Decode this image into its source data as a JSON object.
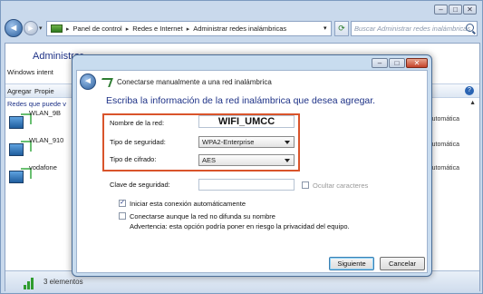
{
  "explorer": {
    "breadcrumb": [
      "Panel de control",
      "Redes e Internet",
      "Administrar redes inalámbricas"
    ],
    "search_placeholder": "Buscar Administrar redes inalámbricas",
    "heading": "Administrar",
    "subtext": "Windows intent",
    "toolbar": [
      "Agregar",
      "Propie"
    ],
    "list_heading": "Redes que puede v",
    "networks": [
      {
        "name": "WLAN_9B",
        "connect": "automática"
      },
      {
        "name": "WLAN_910",
        "connect": "automática"
      },
      {
        "name": "vodafone",
        "connect": "automática"
      }
    ],
    "status_text": "3 elementos"
  },
  "dialog": {
    "title": "Conectarse manualmente a una red inalámbrica",
    "instruction": "Escriba la información de la red inalámbrica que desea agregar.",
    "labels": {
      "network_name": "Nombre de la red:",
      "security_type": "Tipo de seguridad:",
      "encryption_type": "Tipo de cifrado:",
      "security_key": "Clave de seguridad:"
    },
    "values": {
      "network_name": "WIFI_UMCC",
      "security_type": "WPA2-Enterprise",
      "encryption_type": "AES",
      "security_key": ""
    },
    "hide_chars_label": "Ocultar caracteres",
    "auto_connect_label": "Iniciar esta conexión automáticamente",
    "auto_connect_checked": true,
    "hidden_network_label": "Conectarse aunque la red no difunda su nombre",
    "hidden_network_checked": false,
    "warning": "Advertencia: esta opción podría poner en riesgo la privacidad del equipo.",
    "buttons": {
      "next": "Siguiente",
      "cancel": "Cancelar"
    }
  },
  "colors": {
    "highlight": "#d9542b",
    "heading": "#1e3287"
  }
}
